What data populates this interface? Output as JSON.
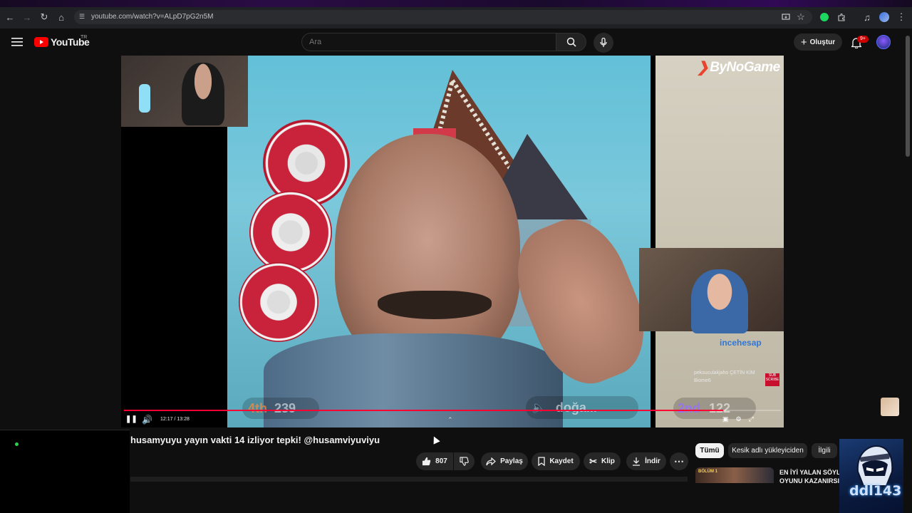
{
  "browser": {
    "url": "youtube.com/watch?v=ALpD7pG2n5M"
  },
  "header": {
    "logo_text": "YouTube",
    "country_code": "TR",
    "search_placeholder": "Ara",
    "create_label": "Oluştur",
    "notification_count": "9+"
  },
  "player": {
    "brand_overlay": "ByNoGame",
    "current_time": "12:17",
    "duration": "13:28",
    "time_separator": " / ",
    "progress": 0.912,
    "rank_left": "4th",
    "score_left": "239",
    "user_tag": "doğa...",
    "rank_right": "2nd",
    "score_right": "122",
    "chat_brand": "incehesap",
    "sub_badge": "SUB SCRIBE",
    "chat_lines": [
      "peksuculakjaho ÇETİN KİM",
      "Biome6"
    ]
  },
  "video": {
    "title": "husamyuyu yayın vakti 14 izliyor tepki! @husamviyuviyu"
  },
  "actions": {
    "likes": "807",
    "share": "Paylaş",
    "save": "Kaydet",
    "clip": "Klip",
    "download": "İndir"
  },
  "filters": [
    "Tümü",
    "Kesik adlı yükleyiciden",
    "İlgili"
  ],
  "recommendation": {
    "title_line1": "EN İYİ YALAN SÖYLE",
    "title_line2": "OYUNU KAZANIRSI",
    "thumb_label": "BÖLÜM 1"
  },
  "streamer_overlay": {
    "name": "ddl143"
  },
  "colors": {
    "accent": "#ff0033",
    "background": "#0f0f0f",
    "chip_bg": "#272727",
    "active_chip": "#f1f1f1"
  }
}
